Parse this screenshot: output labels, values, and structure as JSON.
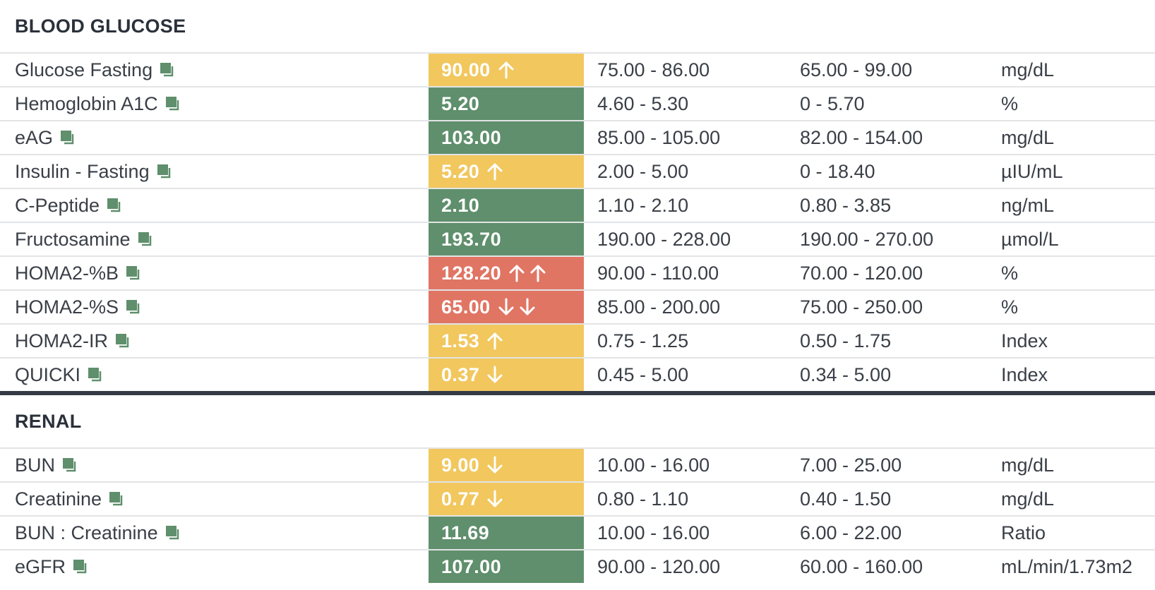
{
  "colors": {
    "optimal": "#5f8f6c",
    "out_of_optimal": "#f1c75e",
    "out_of_range": "#e07564",
    "icon": "#5f8f6c"
  },
  "sections": [
    {
      "title": "BLOOD GLUCOSE",
      "rows": [
        {
          "name": "Glucose Fasting",
          "value": "90.00",
          "status": "out_of_optimal",
          "arrows": [
            "up"
          ],
          "optimal": "75.00 - 86.00",
          "standard": "65.00 - 99.00",
          "unit": "mg/dL"
        },
        {
          "name": "Hemoglobin A1C",
          "value": "5.20",
          "status": "optimal",
          "arrows": [],
          "optimal": "4.60 - 5.30",
          "standard": "0 - 5.70",
          "unit": "%"
        },
        {
          "name": "eAG",
          "value": "103.00",
          "status": "optimal",
          "arrows": [],
          "optimal": "85.00 - 105.00",
          "standard": "82.00 - 154.00",
          "unit": "mg/dL"
        },
        {
          "name": "Insulin - Fasting",
          "value": "5.20",
          "status": "out_of_optimal",
          "arrows": [
            "up"
          ],
          "optimal": "2.00 - 5.00",
          "standard": "0 - 18.40",
          "unit": "µIU/mL"
        },
        {
          "name": "C-Peptide",
          "value": "2.10",
          "status": "optimal",
          "arrows": [],
          "optimal": "1.10 - 2.10",
          "standard": "0.80 - 3.85",
          "unit": "ng/mL"
        },
        {
          "name": "Fructosamine",
          "value": "193.70",
          "status": "optimal",
          "arrows": [],
          "optimal": "190.00 - 228.00",
          "standard": "190.00 - 270.00",
          "unit": "µmol/L"
        },
        {
          "name": "HOMA2-%B",
          "value": "128.20",
          "status": "out_of_range",
          "arrows": [
            "up",
            "up"
          ],
          "optimal": "90.00 - 110.00",
          "standard": "70.00 - 120.00",
          "unit": "%"
        },
        {
          "name": "HOMA2-%S",
          "value": "65.00",
          "status": "out_of_range",
          "arrows": [
            "down",
            "down"
          ],
          "optimal": "85.00 - 200.00",
          "standard": "75.00 - 250.00",
          "unit": "%"
        },
        {
          "name": "HOMA2-IR",
          "value": "1.53",
          "status": "out_of_optimal",
          "arrows": [
            "up"
          ],
          "optimal": "0.75 - 1.25",
          "standard": "0.50 - 1.75",
          "unit": "Index"
        },
        {
          "name": "QUICKI",
          "value": "0.37",
          "status": "out_of_optimal",
          "arrows": [
            "down"
          ],
          "optimal": "0.45 - 5.00",
          "standard": "0.34 - 5.00",
          "unit": "Index"
        }
      ]
    },
    {
      "title": "RENAL",
      "rows": [
        {
          "name": "BUN",
          "value": "9.00",
          "status": "out_of_optimal",
          "arrows": [
            "down"
          ],
          "optimal": "10.00 - 16.00",
          "standard": "7.00 - 25.00",
          "unit": "mg/dL"
        },
        {
          "name": "Creatinine",
          "value": "0.77",
          "status": "out_of_optimal",
          "arrows": [
            "down"
          ],
          "optimal": "0.80 - 1.10",
          "standard": "0.40 - 1.50",
          "unit": "mg/dL"
        },
        {
          "name": "BUN : Creatinine",
          "value": "11.69",
          "status": "optimal",
          "arrows": [],
          "optimal": "10.00 - 16.00",
          "standard": "6.00 - 22.00",
          "unit": "Ratio"
        },
        {
          "name": "eGFR",
          "value": "107.00",
          "status": "optimal",
          "arrows": [],
          "optimal": "90.00 - 120.00",
          "standard": "60.00 - 160.00",
          "unit": "mL/min/1.73m2"
        }
      ]
    }
  ]
}
